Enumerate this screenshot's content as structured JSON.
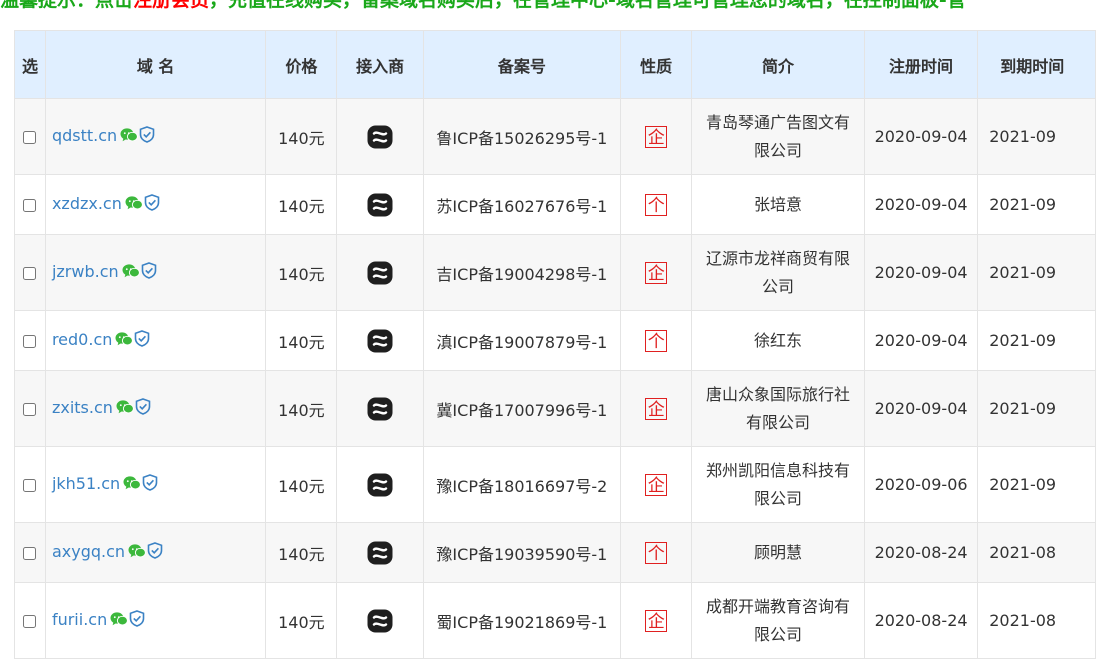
{
  "notice": {
    "prefix": "温馨提示：点击",
    "highlight": "注册会员",
    "suffix": "，充值在线购买，留案域名购买后，在管理中心-域名管理可管理您的域名，在控制面板-管"
  },
  "table": {
    "headers": [
      "选",
      "域 名",
      "价格",
      "接入商",
      "备案号",
      "性质",
      "简介",
      "注册时间",
      "到期时间"
    ],
    "rows": [
      {
        "domain": "qdstt.cn",
        "price": "140元",
        "icp": "鲁ICP备15026295号-1",
        "nature": "企",
        "intro": "青岛琴通广告图文有限公司",
        "reg": "2020-09-04",
        "exp": "2021-09"
      },
      {
        "domain": "xzdzx.cn",
        "price": "140元",
        "icp": "苏ICP备16027676号-1",
        "nature": "个",
        "intro": "张培意",
        "reg": "2020-09-04",
        "exp": "2021-09"
      },
      {
        "domain": "jzrwb.cn",
        "price": "140元",
        "icp": "吉ICP备19004298号-1",
        "nature": "企",
        "intro": "辽源市龙祥商贸有限公司",
        "reg": "2020-09-04",
        "exp": "2021-09"
      },
      {
        "domain": "red0.cn",
        "price": "140元",
        "icp": "滇ICP备19007879号-1",
        "nature": "个",
        "intro": "徐红东",
        "reg": "2020-09-04",
        "exp": "2021-09"
      },
      {
        "domain": "zxits.cn",
        "price": "140元",
        "icp": "冀ICP备17007996号-1",
        "nature": "企",
        "intro": "唐山众象国际旅行社有限公司",
        "reg": "2020-09-04",
        "exp": "2021-09"
      },
      {
        "domain": "jkh51.cn",
        "price": "140元",
        "icp": "豫ICP备18016697号-2",
        "nature": "企",
        "intro": "郑州凯阳信息科技有限公司",
        "reg": "2020-09-06",
        "exp": "2021-09"
      },
      {
        "domain": "axygq.cn",
        "price": "140元",
        "icp": "豫ICP备19039590号-1",
        "nature": "个",
        "intro": "顾明慧",
        "reg": "2020-08-24",
        "exp": "2021-08"
      },
      {
        "domain": "furii.cn",
        "price": "140元",
        "icp": "蜀ICP备19021869号-1",
        "nature": "企",
        "intro": "成都开端教育咨询有限公司",
        "reg": "2020-08-24",
        "exp": "2021-08"
      }
    ]
  },
  "icons": {
    "wechat": "wechat-icon",
    "verified": "verified-shield-icon",
    "provider": "provider-logo-icon"
  },
  "colors": {
    "header_bg": "#e0efff",
    "link": "#3b82c4",
    "nature_red": "#e02020",
    "notice_green": "#1aa81a",
    "notice_red": "#ff0000"
  }
}
